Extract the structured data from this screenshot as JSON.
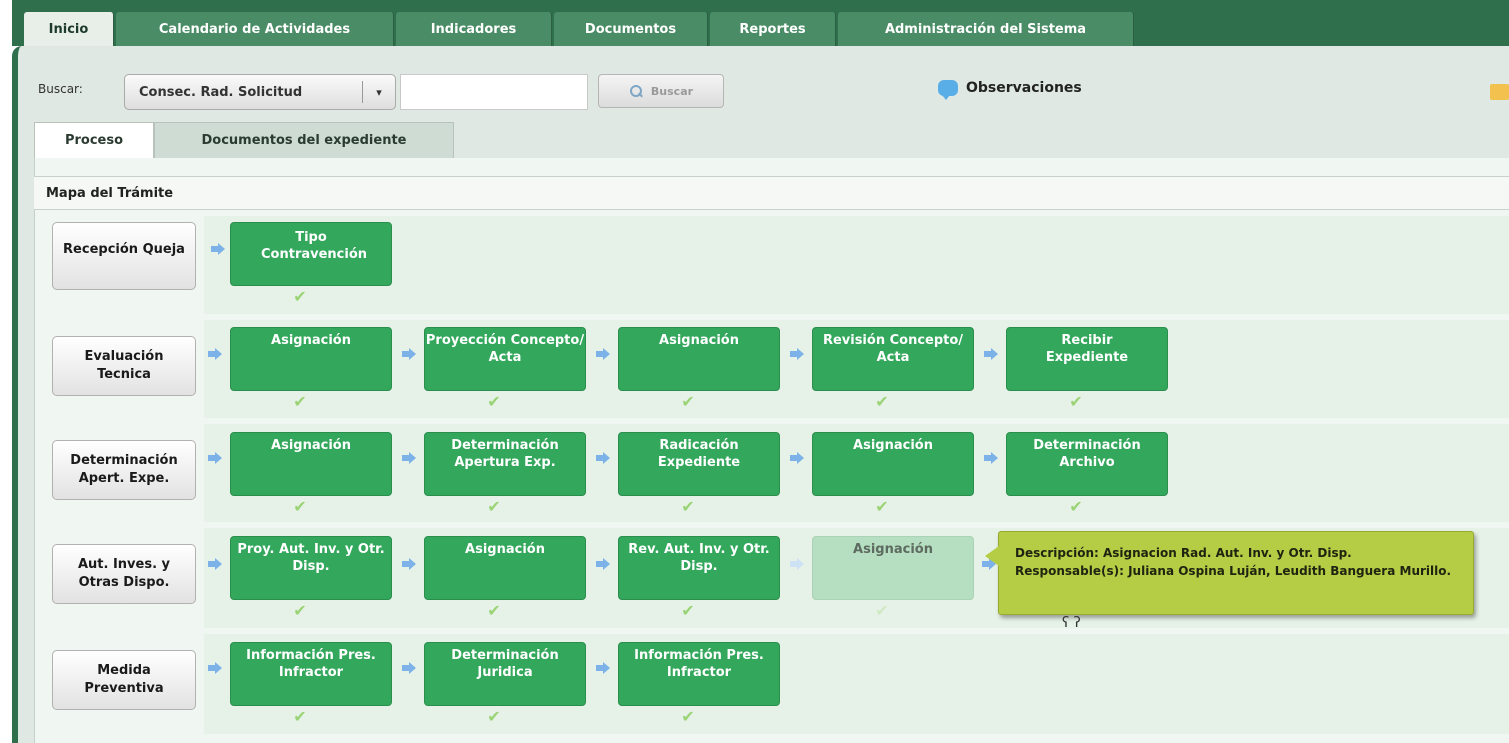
{
  "top_tabs": [
    "Inicio",
    "Calendario de Actividades",
    "Indicadores",
    "Documentos",
    "Reportes",
    "Administración del Sistema"
  ],
  "search": {
    "label": "Buscar:",
    "select_value": "Consec. Rad. Solicitud",
    "select_arrow": "▾",
    "input_value": "",
    "button_label": "Buscar"
  },
  "observaciones_label": "Observaciones",
  "sub_tabs": [
    "Proceso",
    "Documentos del expediente"
  ],
  "map_title": "Mapa del Trámite",
  "rows": [
    {
      "label": "Recepción Queja",
      "nodes": [
        "Tipo Contravención"
      ]
    },
    {
      "label": "Evaluación Tecnica",
      "nodes": [
        "Asignación",
        "Proyección Concepto/ Acta",
        "Asignación",
        "Revisión Concepto/ Acta",
        "Recibir Expediente"
      ]
    },
    {
      "label": "Determinación Apert. Expe.",
      "nodes": [
        "Asignación",
        "Determinación Apertura Exp.",
        "Radicación Expediente",
        "Asignación",
        "Determinación Archivo"
      ]
    },
    {
      "label": "Aut. Inves. y Otras Dispo.",
      "nodes": [
        "Proy. Aut. Inv. y Otr. Disp.",
        "Asignación",
        "Rev. Aut. Inv. y Otr. Disp.",
        "Asignación"
      ]
    },
    {
      "label": "Medida Preventiva",
      "nodes": [
        "Información Pres. Infractor",
        "Determinación Juridica",
        "Información Pres. Infractor"
      ]
    }
  ],
  "tooltip": {
    "line1": "Descripción: Asignacion Rad. Aut. Inv. y Otr. Disp.",
    "line2": "Responsable(s): Juliana  Ospina Luján, Leudith Banguera Murillo."
  },
  "colors": {
    "node_green": "#33a75c",
    "tab_bar": "#2f6f4b",
    "tooltip_bg": "#b5cc45"
  },
  "icons": {
    "check": "✔",
    "cursor": "ʕ ʔ"
  }
}
